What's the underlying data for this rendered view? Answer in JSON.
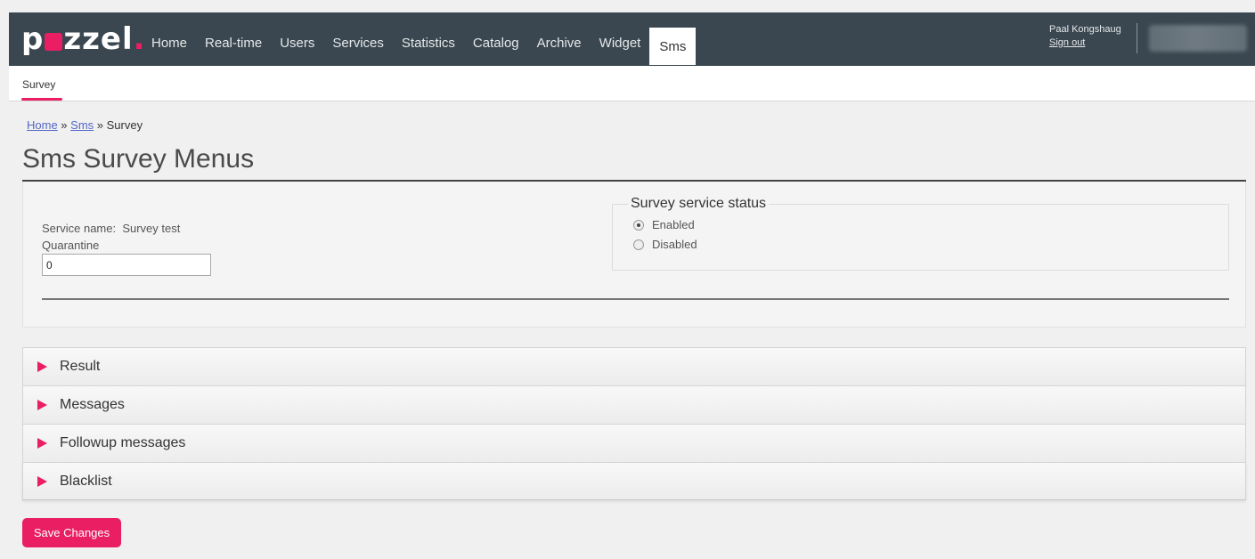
{
  "header": {
    "logo_text": "puzzel",
    "nav": [
      {
        "label": "Home"
      },
      {
        "label": "Real-time"
      },
      {
        "label": "Users"
      },
      {
        "label": "Services"
      },
      {
        "label": "Statistics"
      },
      {
        "label": "Catalog"
      },
      {
        "label": "Archive"
      },
      {
        "label": "Widget"
      },
      {
        "label": "Sms",
        "active": true
      }
    ],
    "user_name": "Paal Kongshaug",
    "sign_out": "Sign out"
  },
  "subnav": {
    "items": [
      {
        "label": "Survey",
        "active": true
      }
    ]
  },
  "breadcrumb": {
    "home": "Home",
    "sep1": " » ",
    "sms": "Sms",
    "sep2": " » ",
    "current": "Survey"
  },
  "page_title": "Sms Survey Menus",
  "service": {
    "name_label": "Service name:",
    "name_value": "Survey test",
    "quarantine_label": "Quarantine",
    "quarantine_value": "0"
  },
  "status": {
    "legend": "Survey service status",
    "options": [
      {
        "label": "Enabled",
        "checked": true
      },
      {
        "label": "Disabled",
        "checked": false
      }
    ]
  },
  "sections": [
    {
      "label": "Result"
    },
    {
      "label": "Messages"
    },
    {
      "label": "Followup messages"
    },
    {
      "label": "Blacklist"
    }
  ],
  "save_label": "Save Changes",
  "colors": {
    "accent": "#e91e63",
    "topbar": "#3a4750",
    "link": "#5468c7"
  }
}
